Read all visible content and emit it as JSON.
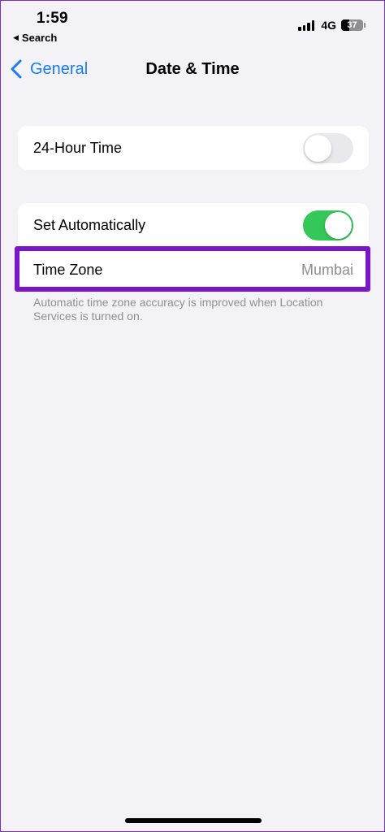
{
  "status_bar": {
    "time": "1:59",
    "back_to_app": "Search",
    "network": "4G",
    "battery_level": "37",
    "battery_fraction": 0.37
  },
  "nav": {
    "back_label": "General",
    "title": "Date & Time"
  },
  "settings": {
    "hour_24": {
      "label": "24-Hour Time",
      "enabled": false
    },
    "set_automatically": {
      "label": "Set Automatically",
      "enabled": true
    },
    "time_zone": {
      "label": "Time Zone",
      "value": "Mumbai"
    }
  },
  "footnote": "Automatic time zone accuracy is improved when Location Services is turned on.",
  "colors": {
    "accent": "#1a7cf5",
    "toggle_on": "#34c759",
    "highlight": "#7a16c8"
  }
}
